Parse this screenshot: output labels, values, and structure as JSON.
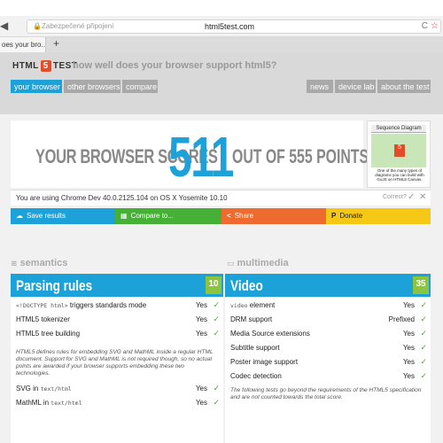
{
  "browser": {
    "address_secure": "Zabezpečené připojení",
    "url": "html5test.com",
    "tab_title": "oes your bro...",
    "new_tab": "+"
  },
  "header": {
    "logo_html": "HTML",
    "logo_5": "5",
    "logo_test": "TEST",
    "tagline": "how well does your browser support html5?",
    "nav_left": [
      "your browser",
      "other browsers",
      "compare"
    ],
    "nav_right": [
      "news",
      "device lab",
      "about the test"
    ]
  },
  "score": {
    "left": "YOUR BROWSER SCORES",
    "value": "511",
    "right": "OUT OF 555 POINTS"
  },
  "ad": {
    "title": "Sequence Diagram",
    "badge": "5",
    "text": "One of the many types of diagrams you can build with GoJS on HTML5 Canvas."
  },
  "ua": {
    "text": "You are using Chrome Dev 40.0.2125.104 on OS X Yosemite 10.10",
    "correct": "Correct?",
    "check": "✓",
    "cross": "✕"
  },
  "share": {
    "save": "Save results",
    "compare": "Compare to...",
    "share": "Share",
    "donate": "Donate"
  },
  "colors": {
    "save": "#1ca2d8",
    "compare": "#45b035",
    "share": "#ee6a2f",
    "donate": "#f5c816"
  },
  "sections": {
    "left": "semantics",
    "right": "multimedia"
  },
  "parsing": {
    "title": "Parsing rules",
    "score": "10",
    "row1_code": "<!DOCTYPE html>",
    "row1_rest": " triggers standards mode",
    "row1_val": "Yes",
    "row2": "HTML5 tokenizer",
    "row2_val": "Yes",
    "row3": "HTML5 tree building",
    "row3_val": "Yes",
    "note": "HTML5 defines rules for embedding SVG and MathML inside a regular HTML document. Support for SVG and MathML is not required though, so no actual points are awarded if your browser supports embedding these two technologies.",
    "row4_pre": "SVG in ",
    "row4_code": "text/html",
    "row4_val": "Yes",
    "row5_pre": "MathML in ",
    "row5_code": "text/html",
    "row5_val": "Yes"
  },
  "video": {
    "title": "Video",
    "score": "35",
    "row1_code": "video",
    "row1_rest": " element",
    "row1_val": "Yes",
    "row2": "DRM support",
    "row2_val": "Prefixed",
    "row3": "Media Source extensions",
    "row3_val": "Yes",
    "row4": "Subtitle support",
    "row4_val": "Yes",
    "row5": "Poster image support",
    "row5_val": "Yes",
    "row6": "Codec detection",
    "row6_val": "Yes",
    "note": "The following tests go beyond the requirements of the HTML5 specification and are not counted towards the total score."
  },
  "check": "✓"
}
